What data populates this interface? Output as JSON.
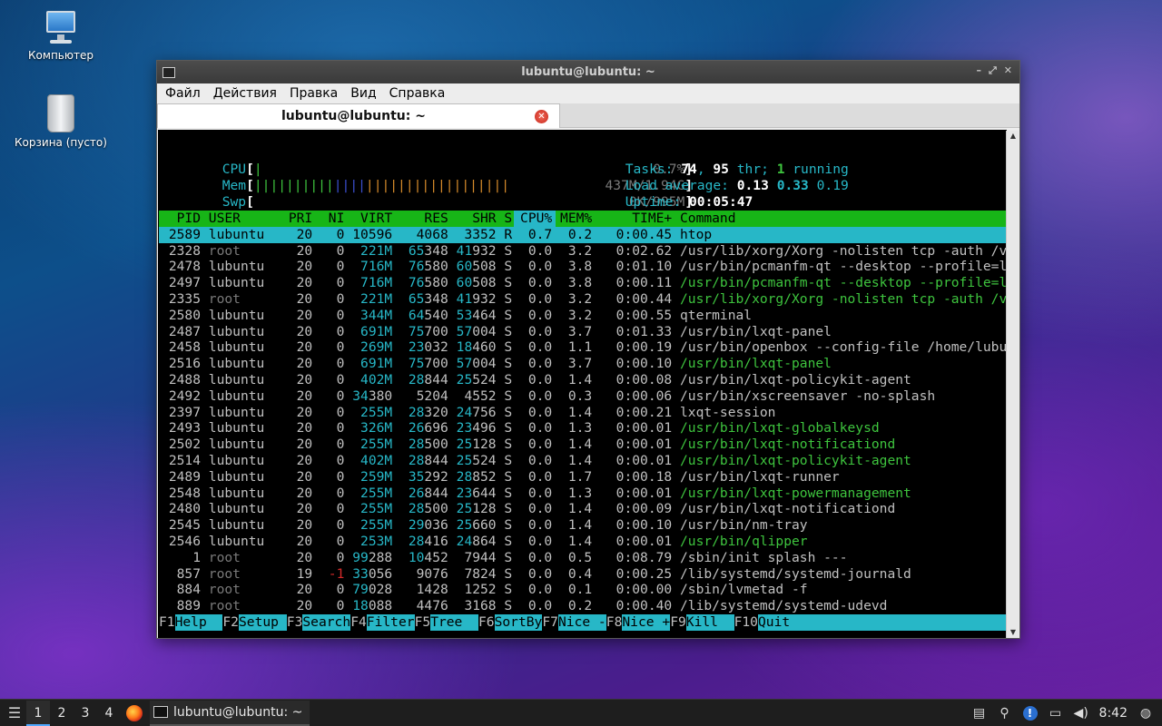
{
  "desktop": {
    "icons": [
      {
        "label": "Компьютер"
      },
      {
        "label": "Корзина (пусто)"
      }
    ]
  },
  "window": {
    "title": "lubuntu@lubuntu: ~",
    "menu": [
      "Файл",
      "Действия",
      "Правка",
      "Вид",
      "Справка"
    ],
    "tab": {
      "label": "lubuntu@lubuntu: ~"
    }
  },
  "htop": {
    "meters": {
      "cpu_label": "CPU",
      "cpu_value": "0.7%",
      "mem_label": "Mem",
      "mem_value": "437M/1.94G",
      "swp_label": "Swp",
      "swp_value": "0K/995M",
      "tasks_label": "Tasks: ",
      "tasks": "74",
      "threads": "95",
      "running": "1",
      "load_label": "Load average: ",
      "load1": "0.13",
      "load5": "0.33",
      "load15": "0.19",
      "uptime_label": "Uptime: ",
      "uptime": "00:05:47"
    },
    "columns": [
      "PID",
      "USER",
      "PRI",
      "NI",
      "VIRT",
      "RES",
      "SHR",
      "S",
      "CPU%",
      "MEM%",
      "TIME+",
      "Command"
    ],
    "processes": [
      {
        "pid": "2589",
        "user": "lubuntu",
        "pri": "20",
        "ni": "0",
        "virt": "10596",
        "res": "4068",
        "shr": "3352",
        "s": "R",
        "cpu": "0.7",
        "mem": "0.2",
        "time": "0:00.45",
        "cmd": "htop",
        "thread": false
      },
      {
        "pid": "2328",
        "user": "root",
        "pri": "20",
        "ni": "0",
        "virt": "221M",
        "res": "65348",
        "shr": "41932",
        "s": "S",
        "cpu": "0.0",
        "mem": "3.2",
        "time": "0:02.62",
        "cmd": "/usr/lib/xorg/Xorg -nolisten tcp -auth /va",
        "thread": false
      },
      {
        "pid": "2478",
        "user": "lubuntu",
        "pri": "20",
        "ni": "0",
        "virt": "716M",
        "res": "76580",
        "shr": "60508",
        "s": "S",
        "cpu": "0.0",
        "mem": "3.8",
        "time": "0:01.10",
        "cmd": "/usr/bin/pcmanfm-qt --desktop --profile=lx",
        "thread": false
      },
      {
        "pid": "2497",
        "user": "lubuntu",
        "pri": "20",
        "ni": "0",
        "virt": "716M",
        "res": "76580",
        "shr": "60508",
        "s": "S",
        "cpu": "0.0",
        "mem": "3.8",
        "time": "0:00.11",
        "cmd": "/usr/bin/pcmanfm-qt --desktop --profile=lx",
        "thread": true
      },
      {
        "pid": "2335",
        "user": "root",
        "pri": "20",
        "ni": "0",
        "virt": "221M",
        "res": "65348",
        "shr": "41932",
        "s": "S",
        "cpu": "0.0",
        "mem": "3.2",
        "time": "0:00.44",
        "cmd": "/usr/lib/xorg/Xorg -nolisten tcp -auth /va",
        "thread": true
      },
      {
        "pid": "2580",
        "user": "lubuntu",
        "pri": "20",
        "ni": "0",
        "virt": "344M",
        "res": "64540",
        "shr": "53464",
        "s": "S",
        "cpu": "0.0",
        "mem": "3.2",
        "time": "0:00.55",
        "cmd": "qterminal",
        "thread": false
      },
      {
        "pid": "2487",
        "user": "lubuntu",
        "pri": "20",
        "ni": "0",
        "virt": "691M",
        "res": "75700",
        "shr": "57004",
        "s": "S",
        "cpu": "0.0",
        "mem": "3.7",
        "time": "0:01.33",
        "cmd": "/usr/bin/lxqt-panel",
        "thread": false
      },
      {
        "pid": "2458",
        "user": "lubuntu",
        "pri": "20",
        "ni": "0",
        "virt": "269M",
        "res": "23032",
        "shr": "18460",
        "s": "S",
        "cpu": "0.0",
        "mem": "1.1",
        "time": "0:00.19",
        "cmd": "/usr/bin/openbox --config-file /home/lubun",
        "thread": false
      },
      {
        "pid": "2516",
        "user": "lubuntu",
        "pri": "20",
        "ni": "0",
        "virt": "691M",
        "res": "75700",
        "shr": "57004",
        "s": "S",
        "cpu": "0.0",
        "mem": "3.7",
        "time": "0:00.10",
        "cmd": "/usr/bin/lxqt-panel",
        "thread": true
      },
      {
        "pid": "2488",
        "user": "lubuntu",
        "pri": "20",
        "ni": "0",
        "virt": "402M",
        "res": "28844",
        "shr": "25524",
        "s": "S",
        "cpu": "0.0",
        "mem": "1.4",
        "time": "0:00.08",
        "cmd": "/usr/bin/lxqt-policykit-agent",
        "thread": false
      },
      {
        "pid": "2492",
        "user": "lubuntu",
        "pri": "20",
        "ni": "0",
        "virt": "34380",
        "res": "5204",
        "shr": "4552",
        "s": "S",
        "cpu": "0.0",
        "mem": "0.3",
        "time": "0:00.06",
        "cmd": "/usr/bin/xscreensaver -no-splash",
        "thread": false
      },
      {
        "pid": "2397",
        "user": "lubuntu",
        "pri": "20",
        "ni": "0",
        "virt": "255M",
        "res": "28320",
        "shr": "24756",
        "s": "S",
        "cpu": "0.0",
        "mem": "1.4",
        "time": "0:00.21",
        "cmd": "lxqt-session",
        "thread": false
      },
      {
        "pid": "2493",
        "user": "lubuntu",
        "pri": "20",
        "ni": "0",
        "virt": "326M",
        "res": "26696",
        "shr": "23496",
        "s": "S",
        "cpu": "0.0",
        "mem": "1.3",
        "time": "0:00.01",
        "cmd": "/usr/bin/lxqt-globalkeysd",
        "thread": true
      },
      {
        "pid": "2502",
        "user": "lubuntu",
        "pri": "20",
        "ni": "0",
        "virt": "255M",
        "res": "28500",
        "shr": "25128",
        "s": "S",
        "cpu": "0.0",
        "mem": "1.4",
        "time": "0:00.01",
        "cmd": "/usr/bin/lxqt-notificationd",
        "thread": true
      },
      {
        "pid": "2514",
        "user": "lubuntu",
        "pri": "20",
        "ni": "0",
        "virt": "402M",
        "res": "28844",
        "shr": "25524",
        "s": "S",
        "cpu": "0.0",
        "mem": "1.4",
        "time": "0:00.01",
        "cmd": "/usr/bin/lxqt-policykit-agent",
        "thread": true
      },
      {
        "pid": "2489",
        "user": "lubuntu",
        "pri": "20",
        "ni": "0",
        "virt": "259M",
        "res": "35292",
        "shr": "28852",
        "s": "S",
        "cpu": "0.0",
        "mem": "1.7",
        "time": "0:00.18",
        "cmd": "/usr/bin/lxqt-runner",
        "thread": false
      },
      {
        "pid": "2548",
        "user": "lubuntu",
        "pri": "20",
        "ni": "0",
        "virt": "255M",
        "res": "26844",
        "shr": "23644",
        "s": "S",
        "cpu": "0.0",
        "mem": "1.3",
        "time": "0:00.01",
        "cmd": "/usr/bin/lxqt-powermanagement",
        "thread": true
      },
      {
        "pid": "2480",
        "user": "lubuntu",
        "pri": "20",
        "ni": "0",
        "virt": "255M",
        "res": "28500",
        "shr": "25128",
        "s": "S",
        "cpu": "0.0",
        "mem": "1.4",
        "time": "0:00.09",
        "cmd": "/usr/bin/lxqt-notificationd",
        "thread": false
      },
      {
        "pid": "2545",
        "user": "lubuntu",
        "pri": "20",
        "ni": "0",
        "virt": "255M",
        "res": "29036",
        "shr": "25660",
        "s": "S",
        "cpu": "0.0",
        "mem": "1.4",
        "time": "0:00.10",
        "cmd": "/usr/bin/nm-tray",
        "thread": false
      },
      {
        "pid": "2546",
        "user": "lubuntu",
        "pri": "20",
        "ni": "0",
        "virt": "253M",
        "res": "28416",
        "shr": "24864",
        "s": "S",
        "cpu": "0.0",
        "mem": "1.4",
        "time": "0:00.01",
        "cmd": "/usr/bin/qlipper",
        "thread": true
      },
      {
        "pid": "1",
        "user": "root",
        "pri": "20",
        "ni": "0",
        "virt": "99288",
        "res": "10452",
        "shr": "7944",
        "s": "S",
        "cpu": "0.0",
        "mem": "0.5",
        "time": "0:08.79",
        "cmd": "/sbin/init splash ---",
        "thread": false
      },
      {
        "pid": "857",
        "user": "root",
        "pri": "19",
        "ni": "-1",
        "virt": "33056",
        "res": "9076",
        "shr": "7824",
        "s": "S",
        "cpu": "0.0",
        "mem": "0.4",
        "time": "0:00.25",
        "cmd": "/lib/systemd/systemd-journald",
        "thread": false
      },
      {
        "pid": "884",
        "user": "root",
        "pri": "20",
        "ni": "0",
        "virt": "79028",
        "res": "1428",
        "shr": "1252",
        "s": "S",
        "cpu": "0.0",
        "mem": "0.1",
        "time": "0:00.00",
        "cmd": "/sbin/lvmetad -f",
        "thread": false
      },
      {
        "pid": "889",
        "user": "root",
        "pri": "20",
        "ni": "0",
        "virt": "18088",
        "res": "4476",
        "shr": "3168",
        "s": "S",
        "cpu": "0.0",
        "mem": "0.2",
        "time": "0:00.40",
        "cmd": "/lib/systemd/systemd-udevd",
        "thread": false
      }
    ],
    "fkeys": [
      {
        "key": "F1",
        "label": "Help  "
      },
      {
        "key": "F2",
        "label": "Setup "
      },
      {
        "key": "F3",
        "label": "Search"
      },
      {
        "key": "F4",
        "label": "Filter"
      },
      {
        "key": "F5",
        "label": "Tree  "
      },
      {
        "key": "F6",
        "label": "SortBy"
      },
      {
        "key": "F7",
        "label": "Nice -"
      },
      {
        "key": "F8",
        "label": "Nice +"
      },
      {
        "key": "F9",
        "label": "Kill  "
      },
      {
        "key": "F10",
        "label": "Quit"
      }
    ]
  },
  "taskbar": {
    "desktops": [
      "1",
      "2",
      "3",
      "4"
    ],
    "task_label": "lubuntu@lubuntu: ~",
    "clock": "8:42"
  },
  "colors": {
    "header_green": "#17b517",
    "highlight_cyan": "#27b7c7",
    "thread_green": "#3ec43e"
  }
}
